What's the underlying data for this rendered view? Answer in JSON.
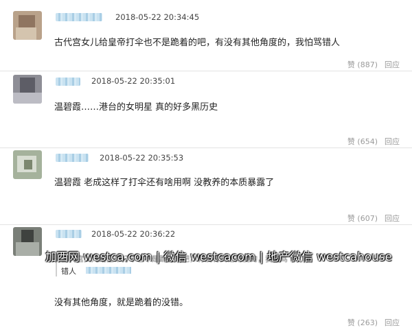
{
  "comments": [
    {
      "timestamp": "2018-05-22 20:34:45",
      "text": "古代宫女儿给皇帝打伞也不是跪着的吧，有没有其他角度的，我怕骂错人",
      "like_label": "赞",
      "like_count": "(887)",
      "reply_label": "回应"
    },
    {
      "timestamp": "2018-05-22 20:35:01",
      "text": "温碧霞……港台的女明星 真的好多黑历史",
      "like_label": "赞",
      "like_count": "(654)",
      "reply_label": "回应"
    },
    {
      "timestamp": "2018-05-22 20:35:53",
      "text": "温碧霞 老成这样了打伞还有啥用啊 没教养的本质暴露了",
      "like_label": "赞",
      "like_count": "(607)",
      "reply_label": "回应"
    },
    {
      "timestamp": "2018-05-22 20:36:22",
      "quote_text": "古代宫女儿给皇帝打伞也不是跪着的吧，有没有其他角度的，我怕骂",
      "quote_user_prefix": "错人",
      "text": "没有其他角度，就是跪着的没错。",
      "like_label": "赞",
      "like_count": "(263)",
      "reply_label": "回应"
    }
  ],
  "watermark": "加西网 westca.com | 微信 westcacom | 地产微信 westcahouse"
}
